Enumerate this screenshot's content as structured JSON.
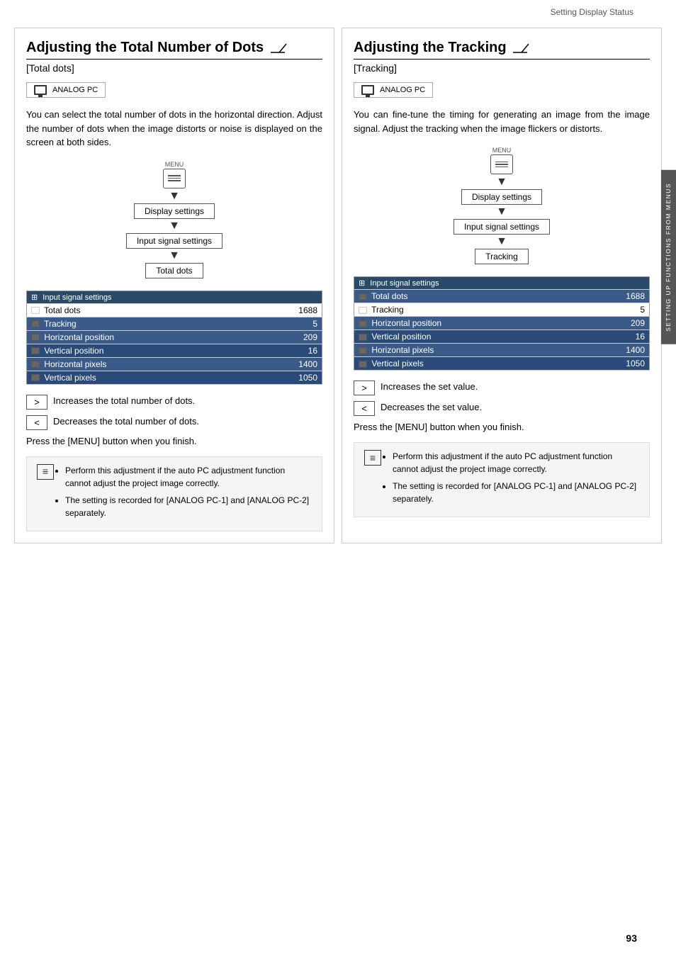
{
  "page": {
    "header": "Setting Display Status",
    "page_number": "93",
    "side_tab": "SETTING UP FUNCTIONS FROM MENUS"
  },
  "left_section": {
    "title": "Adjusting the Total Number of Dots",
    "subtitle": "[Total dots]",
    "analog_pc": "ANALOG PC",
    "body_text": "You can select the total number of dots in the horizontal direction. Adjust the number of dots when the image distorts or noise is displayed on the screen at both sides.",
    "menu_label": "MENU",
    "flow_items": [
      "Display settings",
      "Input signal settings",
      "Total dots"
    ],
    "table": {
      "header": "Input signal settings",
      "rows": [
        {
          "icon": "white",
          "label": "Total dots",
          "value": "1688"
        },
        {
          "icon": "dark",
          "label": "Tracking",
          "value": "5"
        },
        {
          "icon": "dark",
          "label": "Horizontal position",
          "value": "209"
        },
        {
          "icon": "dark",
          "label": "Vertical position",
          "value": "16"
        },
        {
          "icon": "dark",
          "label": "Horizontal pixels",
          "value": "1400"
        },
        {
          "icon": "dark",
          "label": "Vertical pixels",
          "value": "1050"
        }
      ]
    },
    "buttons": [
      {
        "symbol": ">",
        "description": "Increases the total number of dots."
      },
      {
        "symbol": "<",
        "description": "Decreases the total number of dots."
      }
    ],
    "press_text": "Press the [MENU] button when you finish.",
    "notes": [
      "Perform this adjustment if the auto PC adjustment function cannot adjust the project image correctly.",
      "The setting is recorded for [ANALOG PC-1] and [ANALOG PC-2] separately."
    ]
  },
  "right_section": {
    "title": "Adjusting the Tracking",
    "subtitle": "[Tracking]",
    "analog_pc": "ANALOG PC",
    "body_text": "You can fine-tune the timing for generating an image from the image signal. Adjust the tracking when the image flickers or distorts.",
    "menu_label": "MENU",
    "flow_items": [
      "Display settings",
      "Input signal settings",
      "Tracking"
    ],
    "table": {
      "header": "Input signal settings",
      "rows": [
        {
          "icon": "dark",
          "label": "Total dots",
          "value": "1688"
        },
        {
          "icon": "white",
          "label": "Tracking",
          "value": "5"
        },
        {
          "icon": "dark",
          "label": "Horizontal position",
          "value": "209"
        },
        {
          "icon": "dark",
          "label": "Vertical position",
          "value": "16"
        },
        {
          "icon": "dark",
          "label": "Horizontal pixels",
          "value": "1400"
        },
        {
          "icon": "dark",
          "label": "Vertical pixels",
          "value": "1050"
        }
      ]
    },
    "buttons": [
      {
        "symbol": ">",
        "description": "Increases the set value."
      },
      {
        "symbol": "<",
        "description": "Decreases the set value."
      }
    ],
    "press_text": "Press the [MENU] button when you finish.",
    "notes": [
      "Perform this adjustment if the auto PC adjustment function cannot adjust the project image correctly.",
      "The setting is recorded for [ANALOG PC-1] and [ANALOG PC-2] separately."
    ]
  }
}
